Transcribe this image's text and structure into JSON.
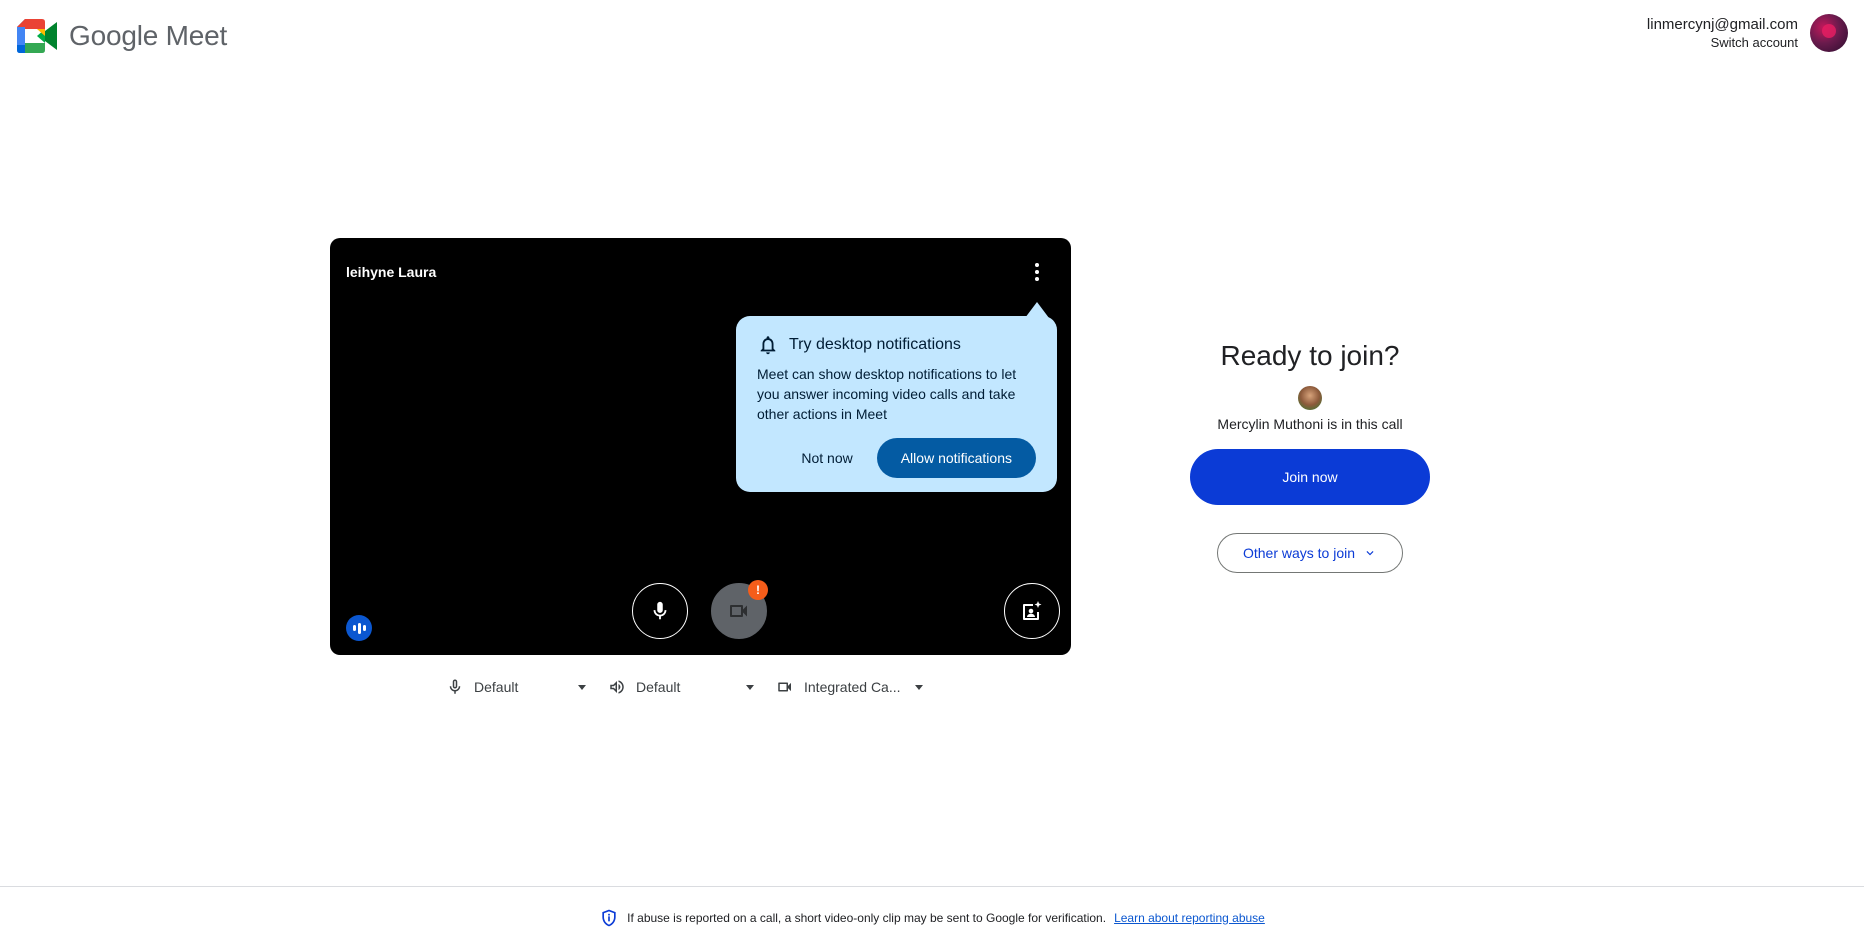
{
  "header": {
    "app_name": "Google Meet",
    "account_email": "linmercynj@gmail.com",
    "switch_account": "Switch account"
  },
  "preview": {
    "self_name": "leihyne Laura",
    "camera_warning": "!"
  },
  "notification_popup": {
    "title": "Try desktop notifications",
    "body": "Meet can show desktop notifications to let you answer incoming video calls and take other actions in Meet",
    "not_now": "Not now",
    "allow": "Allow notifications"
  },
  "devices": {
    "microphone": "Default",
    "speaker": "Default",
    "camera": "Integrated Ca..."
  },
  "join_panel": {
    "title": "Ready to join?",
    "participants": "Mercylin Muthoni is in this call",
    "join_now": "Join now",
    "other_ways": "Other ways to join"
  },
  "footer": {
    "notice": "If abuse is reported on a call, a short video-only clip may be sent to Google for verification.",
    "link": "Learn about reporting abuse"
  },
  "colors": {
    "accent": "#0b3bd6",
    "popup_bg": "#c2e7ff",
    "allow_button": "#045ba3",
    "warning_badge": "#f55d1a"
  }
}
